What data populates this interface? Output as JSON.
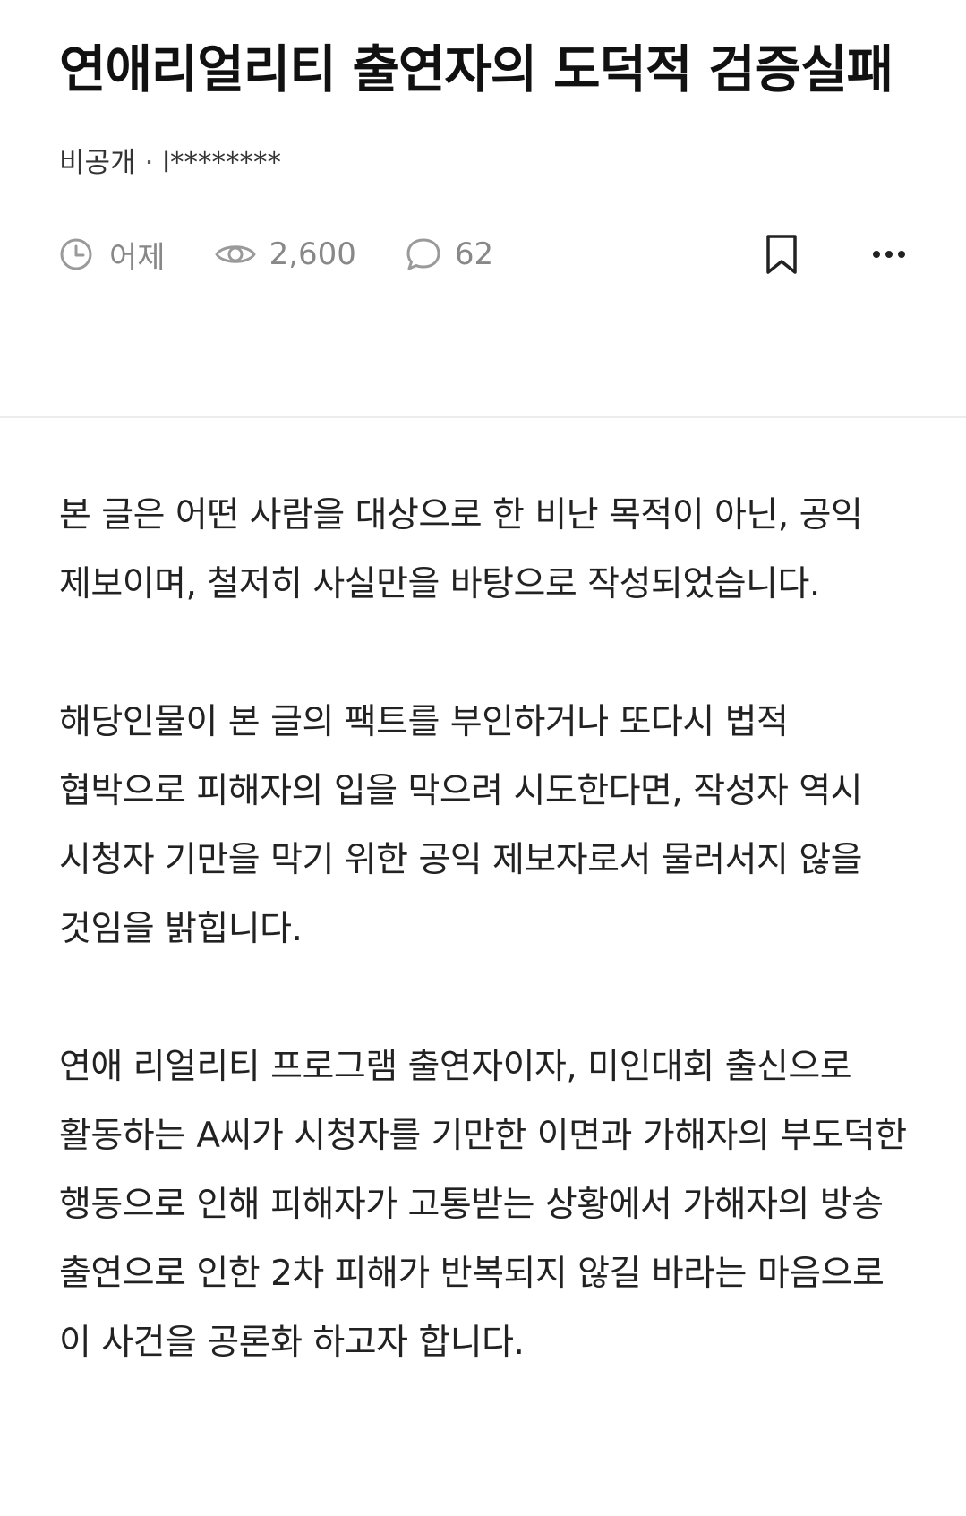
{
  "post": {
    "title": "연애리얼리티 출연자의 도덕적 검증실패",
    "visibility": "비공개",
    "separator": "·",
    "author": "l********",
    "time": "어제",
    "views": "2,600",
    "comments": "62"
  },
  "icons": {
    "time": "clock-icon",
    "views": "eye-icon",
    "comments": "speech-bubble-icon",
    "bookmark": "bookmark-icon",
    "more": "more-dots-icon"
  },
  "body": {
    "paragraphs": [
      "본 글은 어떤 사람을 대상으로 한 비난 목적이 아닌, 공익 제보이며, 철저히 사실만을 바탕으로 작성되었습니다.",
      "해당인물이 본 글의 팩트를 부인하거나 또다시 법적 협박으로 피해자의 입을 막으려 시도한다면, 작성자 역시 시청자 기만을 막기 위한 공익 제보자로서 물러서지 않을 것임을 밝힙니다.",
      "연애 리얼리티 프로그램 출연자이자, 미인대회 출신으로 활동하는 A씨가 시청자를 기만한 이면과 가해자의 부도덕한 행동으로 인해 피해자가 고통받는 상황에서 가해자의 방송 출연으로 인한 2차 피해가 반복되지 않길 바라는 마음으로 이 사건을 공론화 하고자 합니다."
    ]
  },
  "colors": {
    "title": "#111111",
    "meta": "#888888",
    "divider": "#ececec",
    "text": "#222222"
  }
}
